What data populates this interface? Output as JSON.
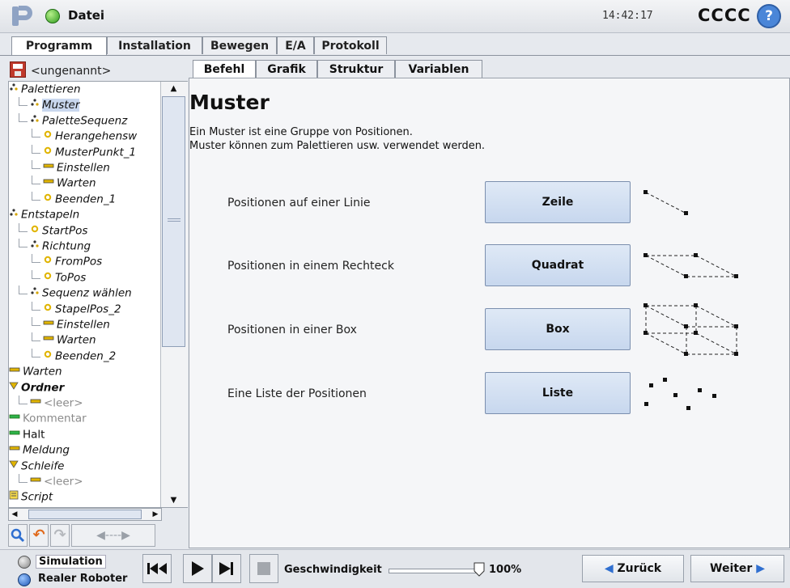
{
  "header": {
    "title": "Datei",
    "time": "14:42:17",
    "robot_name": "CCCC",
    "help_glyph": "?"
  },
  "main_tabs": [
    {
      "label": "Programm",
      "active": true
    },
    {
      "label": "Installation",
      "active": false
    },
    {
      "label": "Bewegen",
      "active": false
    },
    {
      "label": "E/A",
      "active": false
    },
    {
      "label": "Protokoll",
      "active": false
    }
  ],
  "program": {
    "name": "<ungenannt>"
  },
  "tree": [
    {
      "label": "Palettieren",
      "level": 0,
      "icon": "pattern-icon"
    },
    {
      "label": "Muster",
      "level": 1,
      "icon": "pattern-icon",
      "selected": true
    },
    {
      "label": "PaletteSequenz",
      "level": 1,
      "icon": "pattern-icon"
    },
    {
      "label": "Herangehensw",
      "level": 2,
      "icon": "waypoint-icon"
    },
    {
      "label": "MusterPunkt_1",
      "level": 2,
      "icon": "waypoint-icon"
    },
    {
      "label": "Einstellen",
      "level": 2,
      "icon": "set-icon"
    },
    {
      "label": "Warten",
      "level": 2,
      "icon": "set-icon"
    },
    {
      "label": "Beenden_1",
      "level": 2,
      "icon": "waypoint-icon"
    },
    {
      "label": "Entstapeln",
      "level": 0,
      "icon": "pattern-icon"
    },
    {
      "label": "StartPos",
      "level": 1,
      "icon": "waypoint-icon"
    },
    {
      "label": "Richtung",
      "level": 1,
      "icon": "pattern-icon"
    },
    {
      "label": "FromPos",
      "level": 2,
      "icon": "waypoint-icon"
    },
    {
      "label": "ToPos",
      "level": 2,
      "icon": "waypoint-icon"
    },
    {
      "label": "Sequenz wählen",
      "level": 1,
      "icon": "pattern-icon"
    },
    {
      "label": "StapelPos_2",
      "level": 2,
      "icon": "waypoint-icon"
    },
    {
      "label": "Einstellen",
      "level": 2,
      "icon": "set-icon"
    },
    {
      "label": "Warten",
      "level": 2,
      "icon": "set-icon"
    },
    {
      "label": "Beenden_2",
      "level": 2,
      "icon": "waypoint-icon"
    },
    {
      "label": "Warten",
      "level": 0,
      "icon": "set-icon"
    },
    {
      "label": "Ordner",
      "level": 0,
      "icon": "folder-icon",
      "bold": true
    },
    {
      "label": "<leer>",
      "level": 1,
      "icon": "set-icon",
      "gray": true
    },
    {
      "label": "Kommentar",
      "level": 0,
      "icon": "green-bar-icon",
      "gray": true
    },
    {
      "label": "Halt",
      "level": 0,
      "icon": "green-bar-icon",
      "normal": true
    },
    {
      "label": "Meldung",
      "level": 0,
      "icon": "set-icon"
    },
    {
      "label": "Schleife",
      "level": 0,
      "icon": "folder-icon"
    },
    {
      "label": "<leer>",
      "level": 1,
      "icon": "set-icon",
      "gray": true
    },
    {
      "label": "Script",
      "level": 0,
      "icon": "script-icon"
    }
  ],
  "sub_tabs": [
    {
      "label": "Befehl",
      "active": true
    },
    {
      "label": "Grafik",
      "active": false
    },
    {
      "label": "Struktur",
      "active": false
    },
    {
      "label": "Variablen",
      "active": false
    }
  ],
  "content": {
    "heading": "Muster",
    "desc1": "Ein Muster ist eine Gruppe von Positionen.",
    "desc2": "Muster können zum Palettieren usw. verwendet werden.",
    "rows": [
      {
        "label": "Positionen auf einer Linie",
        "button": "Zeile"
      },
      {
        "label": "Positionen in einem Rechteck",
        "button": "Quadrat"
      },
      {
        "label": "Positionen in einer Box",
        "button": "Box"
      },
      {
        "label": "Eine Liste der Positionen",
        "button": "Liste"
      }
    ]
  },
  "footer": {
    "mode_simulation": "Simulation",
    "mode_real": "Realer Roboter",
    "speed_label": "Geschwindigkeit",
    "speed_value": "100%",
    "speed_fraction": 1.0,
    "back_label": "Zurück",
    "next_label": "Weiter"
  },
  "colors": {
    "accent": "#4a86d8",
    "tab_border": "#8c939e",
    "button_fill": "#c7d7ee",
    "waypoint": "#e0b400",
    "set_bar": "#e0b400",
    "green_bar": "#2db34a"
  }
}
